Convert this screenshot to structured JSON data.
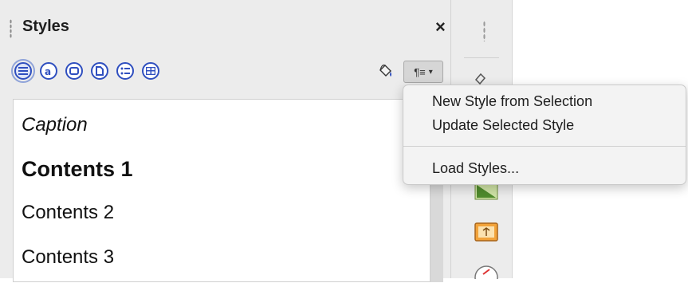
{
  "panel": {
    "title": "Styles",
    "close_glyph": "×",
    "families": [
      {
        "icon": "paragraph-styles-icon",
        "active": true
      },
      {
        "icon": "character-styles-icon",
        "active": false
      },
      {
        "icon": "frame-styles-icon",
        "active": false
      },
      {
        "icon": "page-styles-icon",
        "active": false
      },
      {
        "icon": "list-styles-icon",
        "active": false
      },
      {
        "icon": "table-styles-icon",
        "active": false
      }
    ],
    "fill_format_icon": "paint-bucket-icon",
    "styles_menu_glyph": "¶≡",
    "styles_menu_arrow": "▾",
    "styles": [
      "Caption",
      "Contents 1",
      "Contents 2",
      "Contents 3"
    ]
  },
  "sidebar": {
    "icons": [
      "properties-icon",
      "navigator-icon",
      "gallery-icon",
      "compass-icon"
    ]
  },
  "popup_menu": {
    "items": [
      "New Style from Selection",
      "Update Selected Style",
      "Load Styles..."
    ]
  },
  "colors": {
    "accent": "#2f4fbf",
    "panel_bg": "#ececec",
    "menu_bg": "#f3f3f3"
  }
}
